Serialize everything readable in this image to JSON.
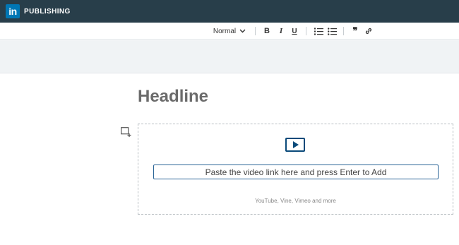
{
  "app": {
    "logo_mark": "in",
    "product": "PUBLISHING"
  },
  "toolbar": {
    "style_select": "Normal",
    "bold": "B",
    "italic": "I",
    "underline": "U",
    "quote": "❞",
    "icons": [
      "numbered-list-icon",
      "bulleted-list-icon",
      "quote-icon",
      "link-icon"
    ]
  },
  "editor": {
    "headline": "Headline",
    "video_embed": {
      "input_placeholder": "Paste the video link here and press Enter to Add",
      "hint": "YouTube, Vine, Vimeo and more"
    }
  },
  "colors": {
    "topbar": "#283e4a",
    "brand": "#0077b5",
    "banner": "#f0f3f5"
  }
}
